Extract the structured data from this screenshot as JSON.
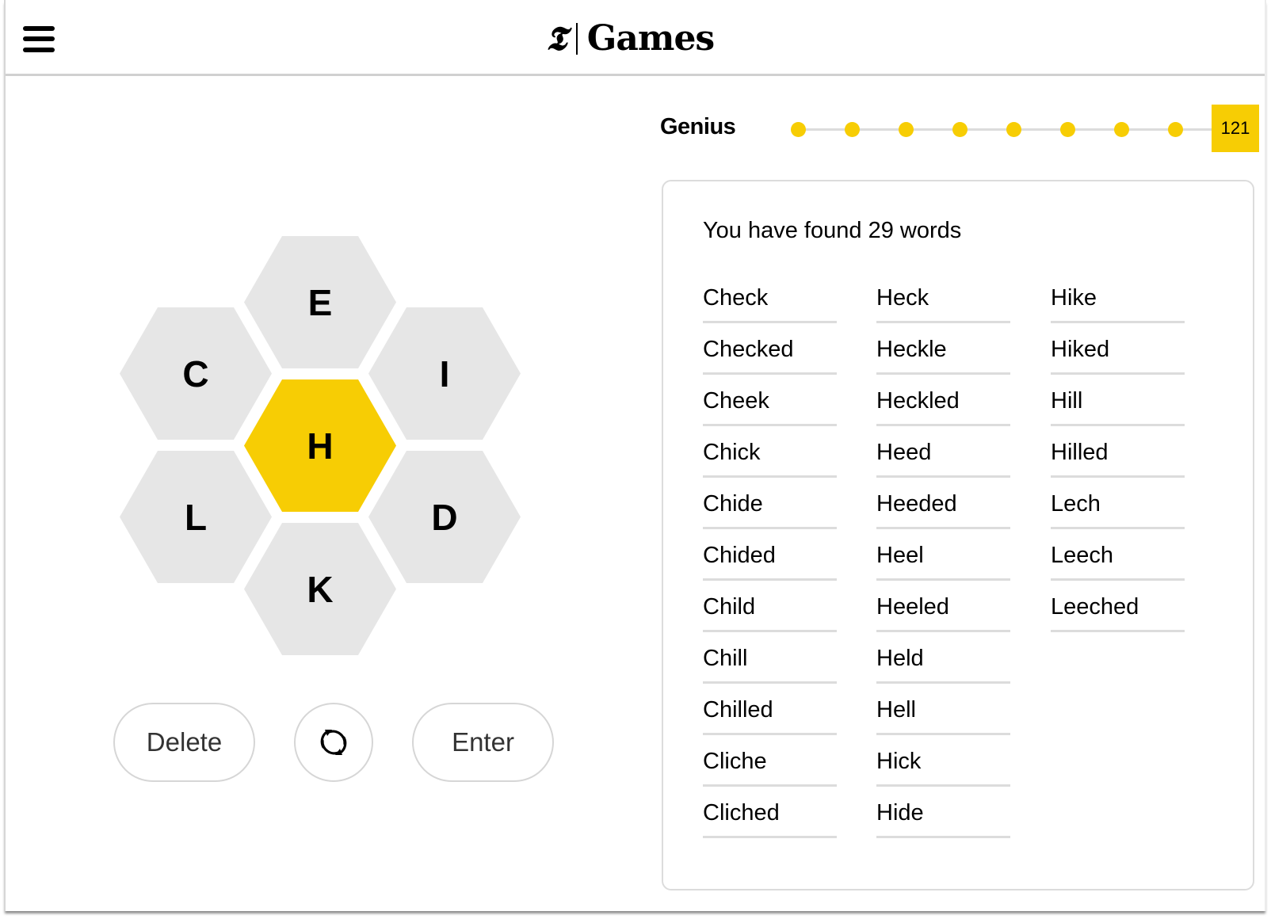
{
  "header": {
    "menu_icon": "hamburger-menu-icon",
    "logo_mark": "𝕿",
    "logo_text": "Games"
  },
  "progress": {
    "rank": "Genius",
    "score": "121",
    "dots_filled": 8,
    "dots_total": 8,
    "accent_color": "#f7cd04"
  },
  "hive": {
    "center_letter": "H",
    "outer_letters": {
      "top": "E",
      "upper_left": "C",
      "upper_right": "I",
      "lower_left": "L",
      "lower_right": "D",
      "bottom": "K"
    },
    "center_color": "#f7cd04",
    "outer_color": "#e6e6e6"
  },
  "actions": {
    "delete_label": "Delete",
    "shuffle_icon": "shuffle-icon",
    "enter_label": "Enter"
  },
  "word_list": {
    "summary": "You have found 29 words",
    "columns": [
      [
        "Check",
        "Checked",
        "Cheek",
        "Chick",
        "Chide",
        "Chided",
        "Child",
        "Chill",
        "Chilled",
        "Cliche",
        "Cliched"
      ],
      [
        "Heck",
        "Heckle",
        "Heckled",
        "Heed",
        "Heeded",
        "Heel",
        "Heeled",
        "Held",
        "Hell",
        "Hick",
        "Hide"
      ],
      [
        "Hike",
        "Hiked",
        "Hill",
        "Hilled",
        "Lech",
        "Leech",
        "Leeched"
      ]
    ]
  }
}
